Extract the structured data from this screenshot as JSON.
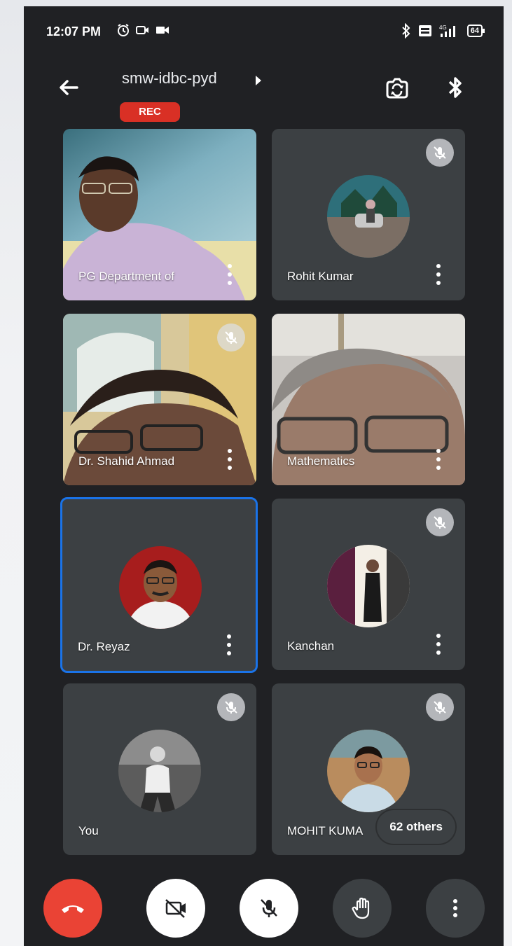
{
  "status_bar": {
    "time": "12:07 PM",
    "battery": "64",
    "network": "4G"
  },
  "header": {
    "meeting_code": "smw-idbc-pyd",
    "rec_label": "REC"
  },
  "tiles": [
    {
      "name": "PG Department of",
      "muted": false,
      "kind": "video"
    },
    {
      "name": "Rohit Kumar",
      "muted": true,
      "kind": "avatar"
    },
    {
      "name": "Dr. Shahid Ahmad",
      "muted": true,
      "kind": "video"
    },
    {
      "name": "Mathematics",
      "muted": false,
      "kind": "video"
    },
    {
      "name": "Dr. Reyaz",
      "muted": false,
      "kind": "avatar",
      "active_speaker": true
    },
    {
      "name": "Kanchan",
      "muted": true,
      "kind": "avatar"
    },
    {
      "name": "You",
      "muted": true,
      "kind": "avatar"
    },
    {
      "name": "MOHIT KUMA",
      "muted": true,
      "kind": "avatar"
    }
  ],
  "others_label": "62 others",
  "controls": {
    "end_call": "end-call",
    "camera_off": "camera-off",
    "mic_off": "mic-off",
    "raise_hand": "raise-hand",
    "more": "more-options"
  },
  "colors": {
    "background": "#202124",
    "tile": "#3c4043",
    "rec": "#d93025",
    "end_call": "#ea4335",
    "active_border": "#1a73e8"
  }
}
